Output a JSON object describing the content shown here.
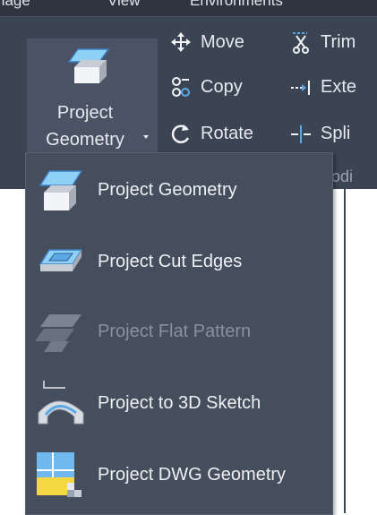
{
  "menubar": {
    "items": [
      "nage",
      "View",
      "Environments"
    ]
  },
  "ribbon": {
    "project_geometry_button": {
      "line1": "Project",
      "line2": "Geometry"
    },
    "modify_col1": [
      {
        "label": "Move",
        "icon": "move-icon"
      },
      {
        "label": "Copy",
        "icon": "copy-icon"
      },
      {
        "label": "Rotate",
        "icon": "rotate-icon"
      }
    ],
    "modify_col2": [
      {
        "label": "Trim",
        "icon": "trim-icon"
      },
      {
        "label": "Exte",
        "icon": "extend-icon"
      },
      {
        "label": "Spli",
        "icon": "split-icon"
      }
    ],
    "panel_label": "odi"
  },
  "dropdown": {
    "items": [
      {
        "label": "Project Geometry",
        "icon": "project-geometry-icon",
        "enabled": true
      },
      {
        "label": "Project Cut Edges",
        "icon": "project-cut-edges-icon",
        "enabled": true
      },
      {
        "label": "Project Flat Pattern",
        "icon": "project-flat-pattern-icon",
        "enabled": false
      },
      {
        "label": "Project to 3D Sketch",
        "icon": "project-to-3d-sketch-icon",
        "enabled": true
      },
      {
        "label": "Project DWG Geometry",
        "icon": "project-dwg-geometry-icon",
        "enabled": true
      }
    ]
  },
  "colors": {
    "ribbon_bg": "#3b4453",
    "dropdown_bg": "#454e5d",
    "accent_blue": "#5aa9e6",
    "text": "#eef0f4",
    "disabled_text": "#8a919d"
  }
}
